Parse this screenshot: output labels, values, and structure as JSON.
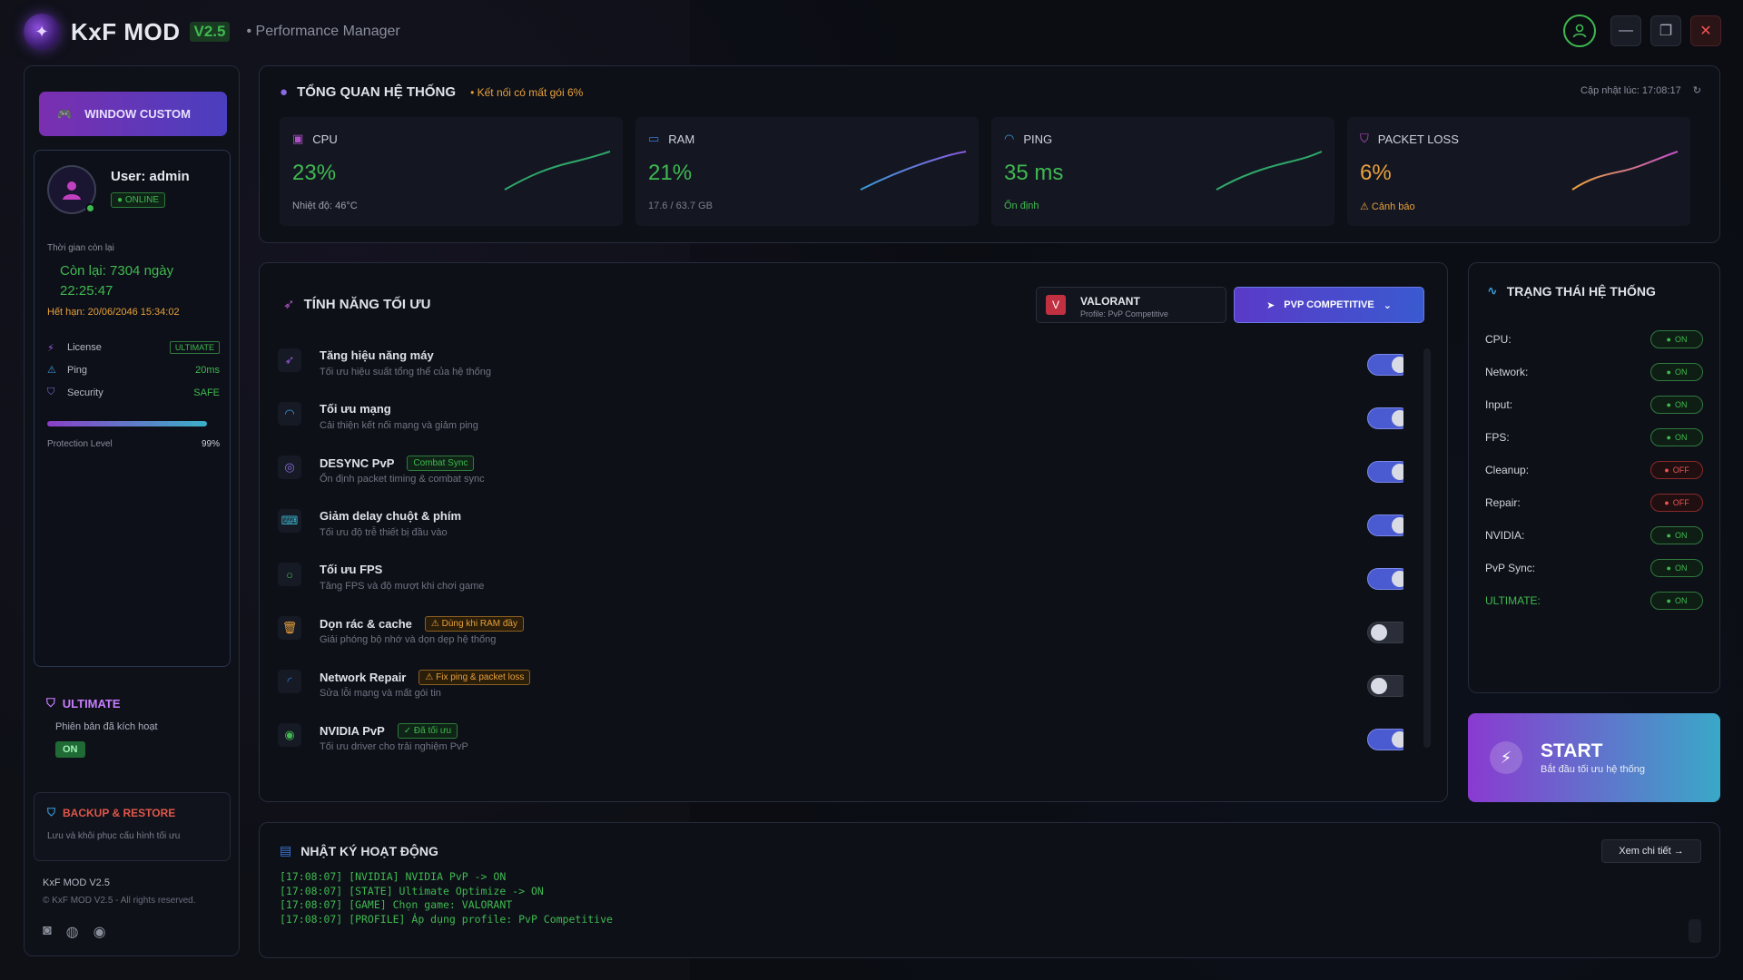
{
  "app": {
    "name": "KxF MOD",
    "version": "V2.5",
    "subtitle": "• Performance Manager"
  },
  "sidebar": {
    "window_custom_label": "WINDOW CUSTOM",
    "user_name": "User: admin",
    "online_label": "● ONLINE",
    "time_label": "Thời gian còn lại",
    "time_left_line1": "Còn lại: 7304 ngày",
    "time_left_line2": "22:25:47",
    "expiry": "Hết hạn: 20/06/2046 15:34:02",
    "info": [
      {
        "label": "License",
        "value": "ULTIMATE",
        "icon": "bolt-icon"
      },
      {
        "label": "Ping",
        "value": "20ms",
        "icon": "warning-icon"
      },
      {
        "label": "Security",
        "value": "SAFE",
        "icon": "shield-icon"
      }
    ],
    "protection_label": "Protection Level",
    "protection_value": "99%",
    "protection_level": 0.99,
    "ultimate": {
      "title": "ULTIMATE",
      "subtitle": "Phiên bản đã kích hoạt",
      "status": "ON"
    },
    "backup": {
      "title": "BACKUP & RESTORE",
      "subtitle": "Lưu và khôi phục cấu hình tối ưu"
    },
    "footer_version": "KxF MOD V2.5",
    "footer_copyright": "© KxF MOD V2.5 - All rights reserved."
  },
  "overview": {
    "title": "TỔNG QUAN HỆ THỐNG",
    "warning": "• Kết nối có mất gói 6%",
    "updated": "Cập nhật lúc: 17:08:17",
    "stats": [
      {
        "label": "CPU",
        "value": "23%",
        "sub": "Nhiệt độ: 46°C",
        "value_color": "#3fb950",
        "sub_color": "#9aa0ac",
        "spark_color": "#2fa86a"
      },
      {
        "label": "RAM",
        "value": "21%",
        "sub": "17.6 / 63.7 GB",
        "value_color": "#3fb950",
        "sub_color": "#7a7f8c",
        "spark_color": "#3a7ad8"
      },
      {
        "label": "PING",
        "value": "35 ms",
        "sub": "Ổn định",
        "value_color": "#3fb950",
        "sub_color": "#3fb950",
        "spark_color": "#2fa86a"
      },
      {
        "label": "PACKET LOSS",
        "value": "6%",
        "sub": "⚠ Cảnh báo",
        "value_color": "#e8a13c",
        "sub_color": "#e8a13c",
        "spark_color": "#e08a3c"
      }
    ]
  },
  "features": {
    "title": "TÍNH NĂNG TỐI ƯU",
    "game_name": "VALORANT",
    "game_profile": "Profile: PvP Competitive",
    "mode_label": "PVP COMPETITIVE",
    "items": [
      {
        "name": "Tăng hiệu năng máy",
        "desc": "Tối ưu hiệu suất tổng thể của hệ thống",
        "tag": "",
        "tag_type": "",
        "on": true,
        "icon": "rocket-icon",
        "icon_color": "#9a5ae0"
      },
      {
        "name": "Tối ưu mạng",
        "desc": "Cải thiện kết nối mạng và giảm ping",
        "tag": "",
        "tag_type": "",
        "on": true,
        "icon": "wifi-icon",
        "icon_color": "#3a9ad8"
      },
      {
        "name": "DESYNC PvP",
        "desc": "Ổn định packet timing & combat sync",
        "tag": "Combat Sync",
        "tag_type": "green",
        "on": true,
        "icon": "target-icon",
        "icon_color": "#8a6ae0"
      },
      {
        "name": "Giảm delay chuột & phím",
        "desc": "Tối ưu độ trễ thiết bị đầu vào",
        "tag": "",
        "tag_type": "",
        "on": true,
        "icon": "keyboard-icon",
        "icon_color": "#3ab0c8"
      },
      {
        "name": "Tối ưu FPS",
        "desc": "Tăng FPS và độ mượt khi chơi game",
        "tag": "",
        "tag_type": "",
        "on": true,
        "icon": "fps-icon",
        "icon_color": "#3fb950"
      },
      {
        "name": "Dọn rác & cache",
        "desc": "Giải phóng bộ nhớ và dọn dẹp hệ thống",
        "tag": "⚠ Dùng khi RAM đầy",
        "tag_type": "orange",
        "on": false,
        "icon": "trash-icon",
        "icon_color": "#e8a13c"
      },
      {
        "name": "Network Repair",
        "desc": "Sửa lỗi mạng và mất gói tin",
        "tag": "⚠ Fix ping & packet loss",
        "tag_type": "orange",
        "on": false,
        "icon": "repair-icon",
        "icon_color": "#3a7ad8"
      },
      {
        "name": "NVIDIA PvP",
        "desc": "Tối ưu driver cho trải nghiệm PvP",
        "tag": "✓ Đã tối ưu",
        "tag_type": "green",
        "on": true,
        "icon": "eye-icon",
        "icon_color": "#3fb950"
      }
    ]
  },
  "status": {
    "title": "TRẠNG THÁI HỆ THỐNG",
    "items": [
      {
        "label": "CPU:",
        "state": "ON",
        "on": true
      },
      {
        "label": "Network:",
        "state": "ON",
        "on": true
      },
      {
        "label": "Input:",
        "state": "ON",
        "on": true
      },
      {
        "label": "FPS:",
        "state": "ON",
        "on": true
      },
      {
        "label": "Cleanup:",
        "state": "OFF",
        "on": false
      },
      {
        "label": "Repair:",
        "state": "OFF",
        "on": false
      },
      {
        "label": "NVIDIA:",
        "state": "ON",
        "on": true
      },
      {
        "label": "PvP Sync:",
        "state": "ON",
        "on": true
      },
      {
        "label": "ULTIMATE:",
        "state": "ON",
        "on": true
      }
    ]
  },
  "start": {
    "title": "START",
    "subtitle": "Bắt đầu tối ưu hệ thống"
  },
  "log": {
    "title": "NHẬT KÝ HOẠT ĐỘNG",
    "detail_label": "Xem chi tiết →",
    "lines": [
      "[17:08:07] [NVIDIA] NVIDIA PvP -> ON",
      "[17:08:07] [STATE] Ultimate Optimize -> ON",
      "[17:08:07] [GAME] Chọn game: VALORANT",
      "[17:08:07] [PROFILE] Áp dụng profile: PvP Competitive"
    ]
  },
  "colors": {
    "accent_purple": "#8a3ad0",
    "accent_cyan": "#3aa8c8",
    "status_green": "#3fb950",
    "status_red": "#f05252",
    "warning_orange": "#e8a13c"
  }
}
